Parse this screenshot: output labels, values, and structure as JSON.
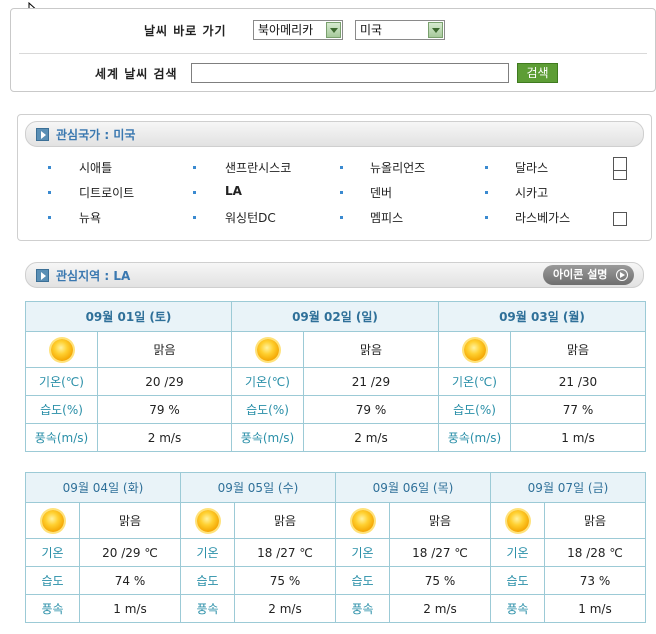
{
  "search": {
    "goto_label": "날씨 바로 가기",
    "region_select": "북아메리카",
    "country_select": "미국",
    "world_label": "세계 날씨 검색",
    "world_input_value": "",
    "search_button": "검색"
  },
  "countries": {
    "title": "관심국가 : 미국",
    "cities": [
      "시애틀",
      "샌프란시스코",
      "뉴올리언즈",
      "달라스",
      "디트로이트",
      "LA",
      "덴버",
      "시카고",
      "뉴욕",
      "워싱턴DC",
      "멤피스",
      "라스베가스"
    ]
  },
  "region": {
    "title": "관심지역 : LA",
    "icon_button": "아이콘 설명"
  },
  "week1": {
    "labels": {
      "temp": "기온(℃)",
      "hum": "습도(%)",
      "wind": "풍속(m/s)"
    },
    "days": [
      {
        "date": "09월 01일 (토)",
        "cond": "맑음",
        "temp": "20 /29",
        "hum": "79 %",
        "wind": "2 m/s"
      },
      {
        "date": "09월 02일 (일)",
        "cond": "맑음",
        "temp": "21 /29",
        "hum": "79 %",
        "wind": "2 m/s"
      },
      {
        "date": "09월 03일 (월)",
        "cond": "맑음",
        "temp": "21 /30",
        "hum": "77 %",
        "wind": "1 m/s"
      }
    ]
  },
  "week2": {
    "labels": {
      "temp": "기온",
      "hum": "습도",
      "wind": "풍속"
    },
    "days": [
      {
        "date": "09월 04일 (화)",
        "cond": "맑음",
        "temp": "20 /29 ℃",
        "hum": "74 %",
        "wind": "1 m/s"
      },
      {
        "date": "09월 05일 (수)",
        "cond": "맑음",
        "temp": "18 /27 ℃",
        "hum": "75 %",
        "wind": "2 m/s"
      },
      {
        "date": "09월 06일 (목)",
        "cond": "맑음",
        "temp": "18 /27 ℃",
        "hum": "75 %",
        "wind": "2 m/s"
      },
      {
        "date": "09월 07일 (금)",
        "cond": "맑음",
        "temp": "18 /28 ℃",
        "hum": "73 %",
        "wind": "1 m/s"
      }
    ]
  }
}
